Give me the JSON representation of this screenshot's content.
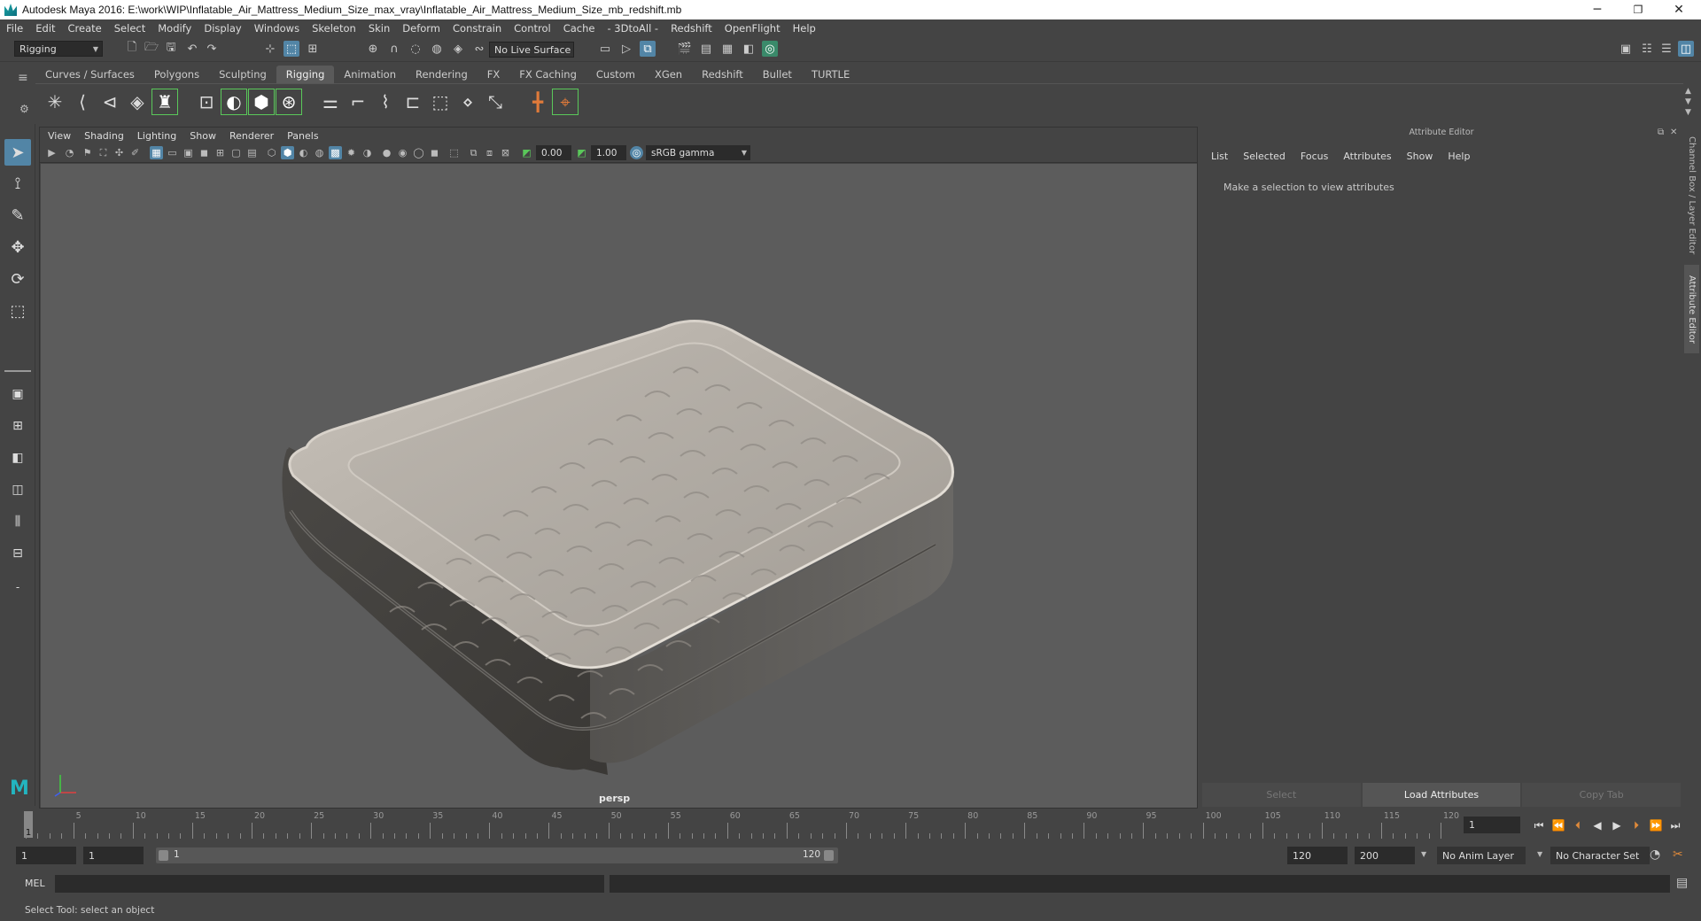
{
  "window": {
    "title": "Autodesk Maya 2016: E:\\work\\WIP\\Inflatable_Air_Mattress_Medium_Size_max_vray\\Inflatable_Air_Mattress_Medium_Size_mb_redshift.mb",
    "minimize": "─",
    "restore": "❐",
    "close": "✕"
  },
  "menubar": [
    "File",
    "Edit",
    "Create",
    "Select",
    "Modify",
    "Display",
    "Windows",
    "Skeleton",
    "Skin",
    "Deform",
    "Constrain",
    "Control",
    "Cache",
    "- 3DtoAll -",
    "Redshift",
    "OpenFlight",
    "Help"
  ],
  "statusline": {
    "mode": "Rigging",
    "live_surface": "No Live Surface"
  },
  "shelf_tabs": [
    {
      "label": "Curves / Surfaces",
      "active": false
    },
    {
      "label": "Polygons",
      "active": false
    },
    {
      "label": "Sculpting",
      "active": false
    },
    {
      "label": "Rigging",
      "active": true
    },
    {
      "label": "Animation",
      "active": false
    },
    {
      "label": "Rendering",
      "active": false
    },
    {
      "label": "FX",
      "active": false
    },
    {
      "label": "FX Caching",
      "active": false
    },
    {
      "label": "Custom",
      "active": false
    },
    {
      "label": "XGen",
      "active": false
    },
    {
      "label": "Redshift",
      "active": false
    },
    {
      "label": "Bullet",
      "active": false
    },
    {
      "label": "TURTLE",
      "active": false
    }
  ],
  "viewport": {
    "menu": [
      "View",
      "Shading",
      "Lighting",
      "Show",
      "Renderer",
      "Panels"
    ],
    "exposure": "0.00",
    "gamma": "1.00",
    "color_space": "sRGB gamma",
    "camera": "persp"
  },
  "attribute_editor": {
    "title": "Attribute Editor",
    "menu": [
      "List",
      "Selected",
      "Focus",
      "Attributes",
      "Show",
      "Help"
    ],
    "message": "Make a selection to view attributes",
    "buttons": {
      "select": "Select",
      "load": "Load Attributes",
      "copy": "Copy Tab"
    }
  },
  "side_tabs": {
    "channel_box": "Channel Box / Layer Editor",
    "attribute_editor": "Attribute Editor"
  },
  "timeline": {
    "labels": [
      "5",
      "10",
      "15",
      "20",
      "25",
      "30",
      "35",
      "40",
      "45",
      "50",
      "55",
      "60",
      "65",
      "70",
      "75",
      "80",
      "85",
      "90",
      "95",
      "100",
      "105",
      "110",
      "115",
      "120"
    ],
    "current_frame": "1",
    "current_frame_field": "1"
  },
  "range": {
    "start": "1",
    "playback_start": "1",
    "slider_start": "1",
    "slider_end": "120",
    "playback_end": "120",
    "end": "200",
    "anim_layer": "No Anim Layer",
    "character_set": "No Character Set"
  },
  "command_line": {
    "lang": "MEL"
  },
  "help_line": "Select Tool: select an object"
}
